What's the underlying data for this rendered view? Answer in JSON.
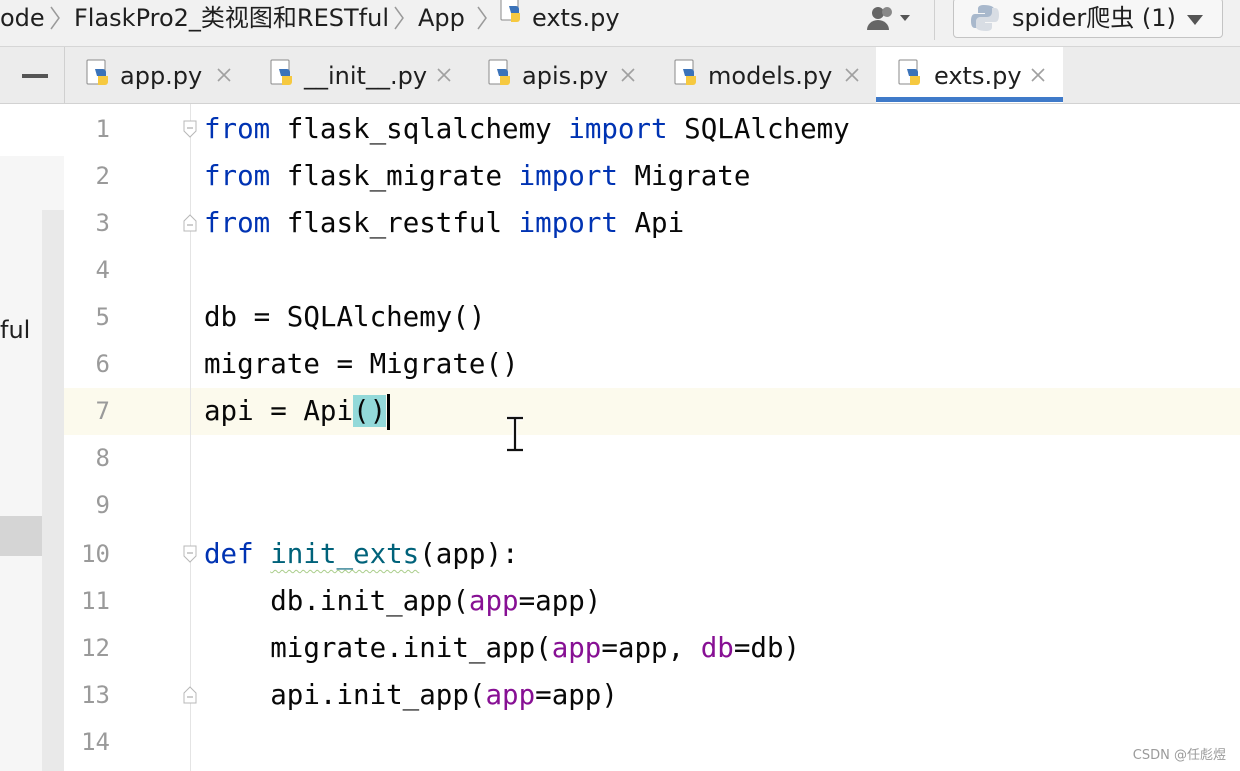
{
  "breadcrumb": {
    "items": [
      "ode",
      "FlaskPro2_类视图和RESTful",
      "App",
      "exts.py"
    ]
  },
  "run_config": {
    "label": "spider爬虫 (1)"
  },
  "tabs": [
    {
      "label": "app.py",
      "active": false
    },
    {
      "label": "__init__.py",
      "active": false
    },
    {
      "label": "apis.py",
      "active": false
    },
    {
      "label": "models.py",
      "active": false
    },
    {
      "label": "exts.py",
      "active": true
    }
  ],
  "project_panel": {
    "partial_text": "ful"
  },
  "editor": {
    "current_line": 7,
    "lines": [
      {
        "n": "1",
        "text": "from flask_sqlalchemy import SQLAlchemy"
      },
      {
        "n": "2",
        "text": "from flask_migrate import Migrate"
      },
      {
        "n": "3",
        "text": "from flask_restful import Api"
      },
      {
        "n": "4",
        "text": ""
      },
      {
        "n": "5",
        "text": "db = SQLAlchemy()"
      },
      {
        "n": "6",
        "text": "migrate = Migrate()"
      },
      {
        "n": "7",
        "text": "api = Api()"
      },
      {
        "n": "8",
        "text": ""
      },
      {
        "n": "9",
        "text": ""
      },
      {
        "n": "10",
        "text": "def init_exts(app):"
      },
      {
        "n": "11",
        "text": "    db.init_app(app=app)"
      },
      {
        "n": "12",
        "text": "    migrate.init_app(app=app, db=db)"
      },
      {
        "n": "13",
        "text": "    api.init_app(app=app)"
      },
      {
        "n": "14",
        "text": ""
      }
    ],
    "tokens": {
      "kw_from": "from",
      "kw_import": "import",
      "kw_def": "def",
      "mod1": "flask_sqlalchemy",
      "mod2": "flask_migrate",
      "mod3": "flask_restful",
      "cls1": "SQLAlchemy",
      "cls2": "Migrate",
      "cls3": "Api",
      "l5": "db = SQLAlchemy()",
      "l6": "migrate = Migrate()",
      "l7a": "api = Api",
      "l7b": "()",
      "fn_name": "init_exts",
      "l10_tail": "(app):",
      "l11_a": "    db.init_app(",
      "l12_a": "    migrate.init_app(",
      "l13_a": "    api.init_app(",
      "p_app": "app",
      "p_db": "db",
      "eq_app_close": "=app)",
      "eq_app_comma": "=app, ",
      "eq_db_close": "=db)"
    }
  },
  "watermark": "CSDN @任彪煜",
  "colors": {
    "keyword": "#0033b3",
    "function": "#00627a",
    "param": "#871094",
    "bracket_highlight": "#93d9d9",
    "caret_row": "#fcfaed",
    "tab_underline": "#3f7ac9"
  }
}
